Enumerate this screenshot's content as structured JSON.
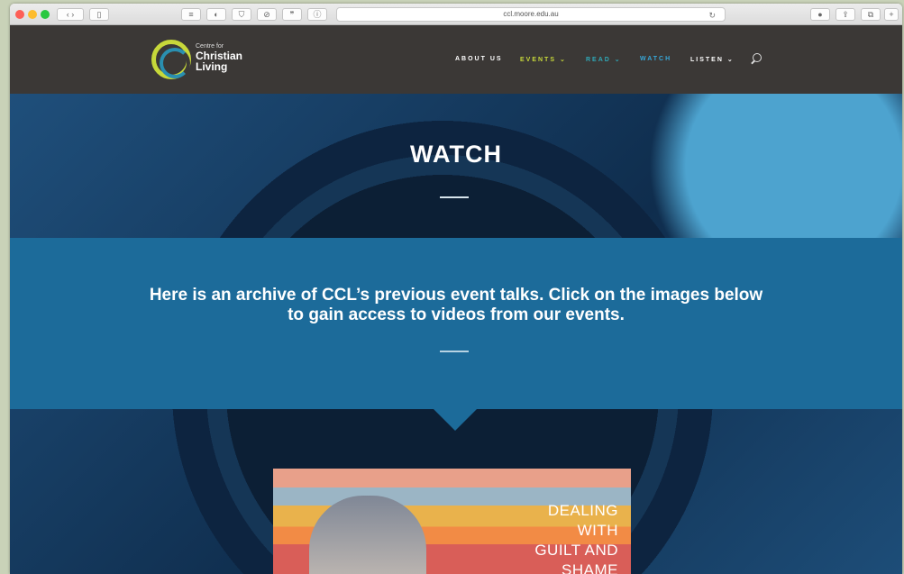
{
  "browser": {
    "url": "ccl.moore.edu.au"
  },
  "site": {
    "logo_small": "Centre for",
    "logo_line1": "Christian",
    "logo_line2": "Living",
    "nav": [
      {
        "label": "ABOUT US",
        "color": "#ffffff"
      },
      {
        "label": "EVENTS ⌄",
        "color": "#c7d83a"
      },
      {
        "label": "READ ⌄",
        "color": "#2fa8b7"
      },
      {
        "label": "WATCH",
        "color": "#37a7d8"
      },
      {
        "label": "LISTEN ⌄",
        "color": "#ffffff"
      }
    ]
  },
  "hero": {
    "title": "WATCH"
  },
  "band": {
    "text": "Here is an archive of CCL’s previous event talks. Click on the images below to gain access to videos from our events."
  },
  "thumbnail": {
    "lines": [
      "DEALING",
      "WITH",
      "GUILT AND",
      "SHAME"
    ]
  },
  "colors": {
    "header_bg": "#3b3836",
    "band_bg": "#1c6b9a",
    "accent_green": "#c7d83a"
  }
}
